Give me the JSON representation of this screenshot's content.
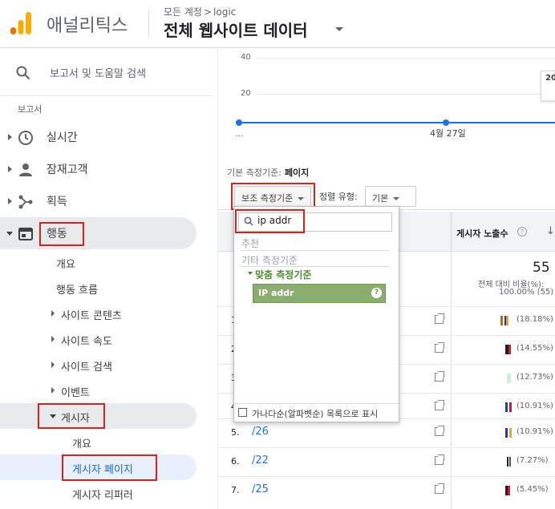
{
  "header": {
    "app_name": "애널리틱스",
    "breadcrumb": [
      "모든 계정",
      "logic"
    ],
    "breadcrumb_sep": ">",
    "view_title": "전체 웹사이트 데이터"
  },
  "sidebar": {
    "search_label": "보고서 및 도움말 검색",
    "reports_heading": "보고서",
    "items": [
      {
        "label": "실시간",
        "icon": "clock-icon"
      },
      {
        "label": "잠재고객",
        "icon": "person-icon"
      },
      {
        "label": "획득",
        "icon": "acquisition-icon"
      },
      {
        "label": "행동",
        "icon": "behavior-icon"
      }
    ],
    "behavior_sub": [
      "개요",
      "행동 흐름",
      "사이트 콘텐츠",
      "사이트 속도",
      "사이트 검색",
      "이벤트",
      "게시자"
    ],
    "publisher_sub": [
      "개요",
      "게시자 페이지",
      "게시자 리퍼러"
    ]
  },
  "chart": {
    "y_ticks": [
      "40",
      "20"
    ],
    "ellipsis": "...",
    "date_label": "4월 27일",
    "tooltip_text": "20"
  },
  "controls": {
    "primary_dim_label": "기본 측정기준:",
    "primary_dim_value": "페이지",
    "secondary_dim_button": "보조 측정기준",
    "sort_label": "정렬 유형:",
    "sort_value": "기본"
  },
  "table": {
    "column_header": "게시자 노출수",
    "help": "?",
    "sort_arrow": "↓",
    "total_value": "55",
    "total_pct_label": "전체 대비 비율(%):",
    "total_pct_value": "100.00% (55)",
    "rows": [
      {
        "num": "1.",
        "page": "",
        "pct": "(18.18%)"
      },
      {
        "num": "2.",
        "page": "",
        "pct": "(14.55%)"
      },
      {
        "num": "3.",
        "page": "",
        "pct": "(12.73%)"
      },
      {
        "num": "4.",
        "page": "",
        "pct": "(10.91%)"
      },
      {
        "num": "5.",
        "page": "/26",
        "pct": "(10.91%)"
      },
      {
        "num": "6.",
        "page": "/22",
        "pct": "(7.27%)"
      },
      {
        "num": "7.",
        "page": "/25",
        "pct": "(5.45%)"
      }
    ]
  },
  "dropdown": {
    "search_value": "ip addr",
    "section_recommended": "추천",
    "section_other": "기타 측정기준",
    "section_custom": "맞춤 측정기준",
    "selected_item": "IP addr",
    "help": "?",
    "checkbox_label": "가나다순(알파벳순) 목록으로 표시"
  },
  "colors": {
    "accent_blue": "#1a73e8",
    "highlight_red": "#e0201b",
    "selection_green": "#8bae6f",
    "logo_orange": "#f9ab00",
    "logo_dark": "#e37400"
  }
}
